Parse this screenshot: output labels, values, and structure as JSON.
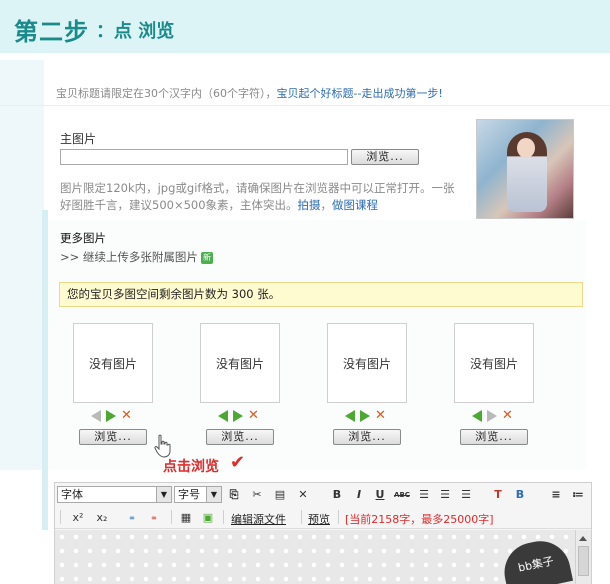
{
  "header": {
    "step": "第二步",
    "sub": "：点 浏览"
  },
  "title_tip": {
    "text": "宝贝标题请限定在30个汉字内（60个字符），",
    "link": "宝贝起个好标题--走出成功第一步!"
  },
  "main_image": {
    "label": "主图片",
    "input_value": "",
    "browse_label": "浏览...",
    "desc": "图片限定120k内，jpg或gif格式，请确保图片在浏览器中可以正常打开。一张好图胜千言，建议500×500象素，主体突出。",
    "link_shoot": "拍摄",
    "link_course": "做图课程"
  },
  "more_images": {
    "title": "更多图片",
    "link": ">> 继续上传多张附属图片",
    "badge": "新",
    "notice": "您的宝贝多图空间剩余图片数为 300 张。",
    "slots": [
      {
        "empty": "没有图片",
        "browse": "浏览..."
      },
      {
        "empty": "没有图片",
        "browse": "浏览..."
      },
      {
        "empty": "没有图片",
        "browse": "浏览..."
      },
      {
        "empty": "没有图片",
        "browse": "浏览..."
      }
    ],
    "click_tip": "点击浏览",
    "check_mark": "✔"
  },
  "editor": {
    "font_select": "字体",
    "size_select": "字号",
    "toolbar_row1": [
      "copy",
      "cut",
      "paste",
      "clear",
      "bold",
      "italic",
      "underline",
      "strikethrough",
      "align-left",
      "align-center",
      "align-right",
      "font-color",
      "bg-color",
      "ordered-list",
      "unordered-list"
    ],
    "bold": "B",
    "italic": "I",
    "underline": "U",
    "strike": "ABC",
    "sup": "x²",
    "sub": "x₂",
    "edit_source": "编辑源文件",
    "preview": "预览",
    "word_count": "[当前2158字，最多25000字]",
    "stamp_text": "bb集子"
  },
  "colors": {
    "header_bg": "#ddf4f6",
    "header_text": "#1a8a8a",
    "link": "#2b6cb5",
    "notice_bg": "#fffbd0",
    "accent_red": "#e02a2a"
  }
}
